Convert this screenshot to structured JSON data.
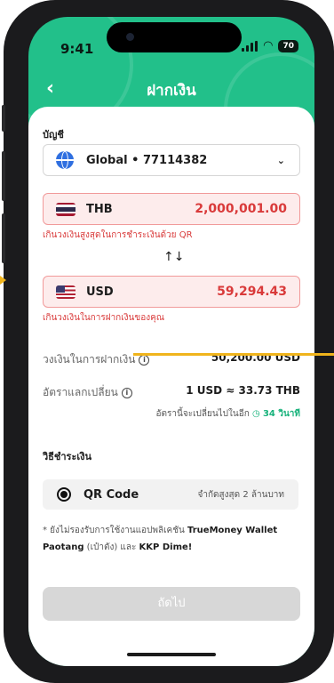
{
  "status": {
    "time": "9:41",
    "battery": "70"
  },
  "nav": {
    "title": "ฝากเงิน",
    "back": "‹"
  },
  "account": {
    "label": "บัญชี",
    "value": "Global • 77114382"
  },
  "from": {
    "currency": "THB",
    "amount": "2,000,001.00",
    "error": "เกินวงเงินสูงสุดในการชำระเงินด้วย QR"
  },
  "swap_icon": "↑↓",
  "to": {
    "currency": "USD",
    "amount": "59,294.43",
    "error": "เกินวงเงินในการฝากเงินของคุณ"
  },
  "limit": {
    "label": "วงเงินในการฝากเงิน",
    "value": "50,200.00 USD"
  },
  "rate": {
    "label": "อัตราแลกเปลี่ยน",
    "value": "1 USD ≈ 33.73 THB",
    "refresh_note": "อัตรานี้จะเปลี่ยนไปในอีก",
    "countdown": "34 วินาที"
  },
  "payment": {
    "label": "วิธีชำระเงิน",
    "method": "QR Code",
    "method_limit": "จำกัดสูงสุด 2 ล้านบาท"
  },
  "footnote": {
    "prefix": "* ยังไม่รองรับการใช้งานแอปพลิเคชัน",
    "app1": "TrueMoney Wallet Paotang",
    "mid": "(เป๋าตัง) และ",
    "app2": "KKP Dime!"
  },
  "next_button": "ถัดไป",
  "colors": {
    "brand": "#22c08a",
    "error": "#d93a3a",
    "callout": "#f0b41c"
  },
  "icons": {
    "globe": "globe-icon",
    "info": "info-icon",
    "clock": "clock-icon",
    "back": "chevron-left-icon",
    "dropdown": "chevron-down-icon"
  }
}
